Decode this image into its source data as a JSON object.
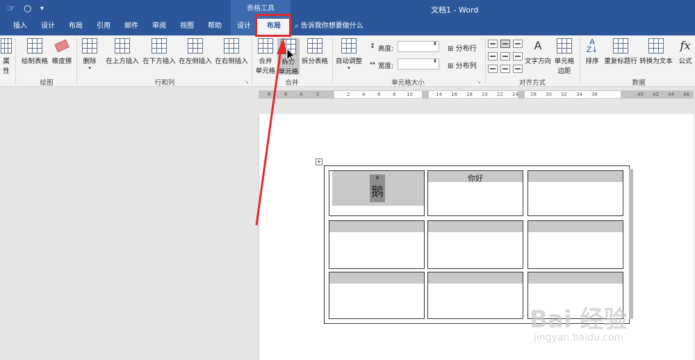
{
  "titlebar": {
    "context_group": "表格工具",
    "doc_title": "文档1  -  Word"
  },
  "tabs": {
    "insert": "插入",
    "design": "设计",
    "layout": "布局",
    "references": "引用",
    "mailings": "邮件",
    "review": "审阅",
    "view": "视图",
    "help": "帮助",
    "table_design": "设计",
    "table_layout": "布局",
    "tell_me": "告诉我你想要做什么"
  },
  "ribbon": {
    "properties": "属性",
    "draw_table": "绘制表格",
    "eraser": "橡皮擦",
    "group_draw": "绘图",
    "delete": "删除",
    "insert_above": "在上方插入",
    "insert_below": "在下方插入",
    "insert_left": "在左侧插入",
    "insert_right": "在右侧插入",
    "group_rows_cols": "行和列",
    "merge_cells_1": "合并",
    "merge_cells_2": "单元格",
    "split_cells_1": "拆分",
    "split_cells_2": "单元格",
    "split_table": "拆分表格",
    "group_merge": "合并",
    "autofit": "自动调整",
    "height_label": "高度:",
    "width_label": "宽度:",
    "distribute_rows": "分布行",
    "distribute_cols": "分布列",
    "group_cell_size": "单元格大小",
    "text_direction": "文字方向",
    "cell_margins_1": "单元格",
    "cell_margins_2": "边距",
    "group_alignment": "对齐方式",
    "sort": "排序",
    "repeat_header": "重复标题行",
    "convert_to_text": "转换为文本",
    "formula": "公式",
    "group_data": "数据"
  },
  "ruler_ticks": [
    "8",
    "6",
    "4",
    "2",
    "2",
    "4",
    "6",
    "8",
    "10",
    "14",
    "16",
    "18",
    "20",
    "22",
    "24",
    "28",
    "30",
    "32",
    "34",
    "36",
    "40",
    "42",
    "44",
    "46"
  ],
  "table": {
    "cells": [
      "鹅",
      "你好",
      "",
      "",
      "",
      "",
      "",
      "",
      ""
    ],
    "pinyin": "é"
  },
  "watermark": {
    "brand": "Bai 经验",
    "url": "jingyan.baidu.com"
  }
}
